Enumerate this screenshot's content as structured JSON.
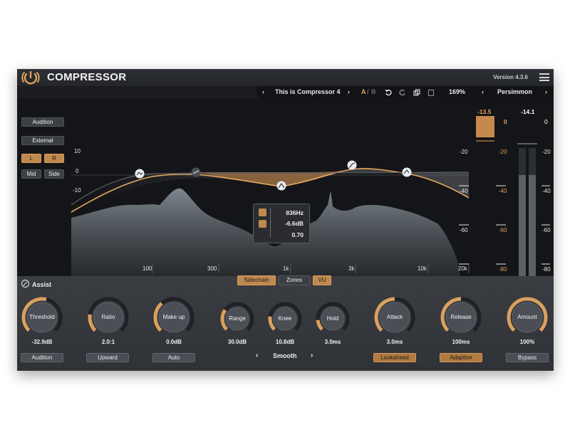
{
  "app": {
    "title": "COMPRESSOR",
    "version": "Version 4.3.6"
  },
  "toolbar": {
    "prev_preset": "‹",
    "preset_name": "This is Compressor 4",
    "next_preset": "›",
    "a": "A",
    "slash": "/",
    "b": "B",
    "zoom": "169%",
    "prev_theme": "‹",
    "theme": "Persimmon",
    "next_theme": "›"
  },
  "side_buttons": {
    "audition": "Audition",
    "external": "External",
    "l": "L",
    "r": "R",
    "mid": "Mid",
    "side": "Side"
  },
  "graph": {
    "left_scale": [
      "10",
      "0",
      "-10"
    ],
    "right_scale": [
      "-20",
      "-40",
      "-60"
    ],
    "freq_labels": [
      "100",
      "300",
      "1k",
      "3k",
      "10k",
      "20k"
    ]
  },
  "meters": {
    "gr_top": "-13.5",
    "gr_zero": "0",
    "out_top": "-14.1",
    "out_zero": "0",
    "scale": [
      "-20",
      "-40",
      "-60",
      "-80"
    ],
    "gr_level": 0.2,
    "out_left_level": 0.72,
    "out_right_level": 0.72
  },
  "tooltip": {
    "freq": "836Hz",
    "gain": "-6.6dB",
    "q": "0.70"
  },
  "tabs": {
    "sidechain": "Sidechain",
    "zones": "Zones",
    "vu": "VU"
  },
  "assist": {
    "label": "Assist"
  },
  "knobs": [
    {
      "name": "threshold",
      "label": "Threshold",
      "value": "-32.9dB",
      "level": 0.55
    },
    {
      "name": "ratio",
      "label": "Ratio",
      "value": "2.0:1",
      "level": 0.2
    },
    {
      "name": "make-up",
      "label": "Make up",
      "value": "0.0dB",
      "level": 0.35
    },
    {
      "name": "range",
      "label": "Range",
      "value": "30.0dB",
      "level": 0.3
    },
    {
      "name": "knee",
      "label": "Knee",
      "value": "10.8dB",
      "level": 0.2
    },
    {
      "name": "hold",
      "label": "Hold",
      "value": "3.0ms",
      "level": 0.15
    },
    {
      "name": "attack",
      "label": "Attack",
      "value": "3.0ms",
      "level": 0.5
    },
    {
      "name": "release",
      "label": "Release",
      "value": "100ms",
      "level": 0.5
    },
    {
      "name": "amount",
      "label": "Amount",
      "value": "100%",
      "level": 1.0
    }
  ],
  "bottom_buttons": {
    "audition": "Audition",
    "upward": "Upward",
    "auto": "Auto",
    "smooth_prev": "‹",
    "smooth": "Smooth",
    "smooth_next": "›",
    "lookahead": "Lookahead",
    "adaptive": "Adaptive",
    "bypass": "Bypass"
  },
  "colors": {
    "accent": "#d9a05e",
    "accent_dim": "#b07a40",
    "bg": "#141518"
  }
}
